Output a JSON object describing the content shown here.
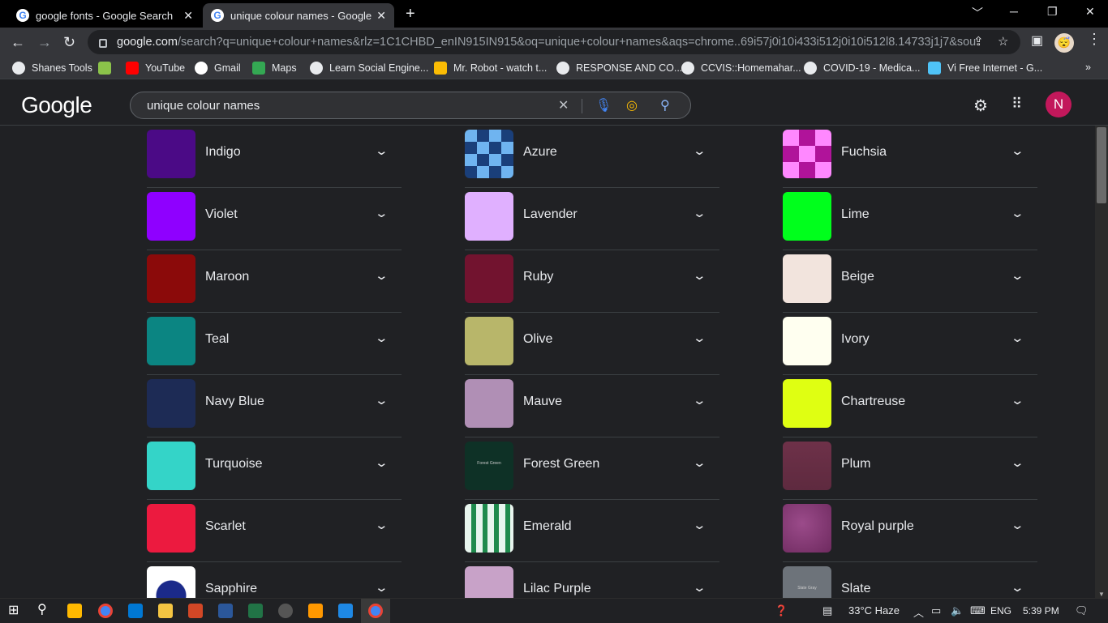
{
  "tabs": [
    {
      "title": "google fonts - Google Search",
      "active": false
    },
    {
      "title": "unique colour names - Google Se",
      "active": true
    }
  ],
  "address_bar": {
    "domain": "google.com",
    "path": "/search?q=unique+colour+names&rlz=1C1CHBD_enIN915IN915&oq=unique+colour+names&aqs=chrome..69i57j0i10i433i512j0i10i512l8.14733j1j7&sourc..."
  },
  "profile_icon": "😴",
  "bookmarks": [
    {
      "label": "Shanes Tools",
      "icon": "globe-icon",
      "color": "#e8eaed"
    },
    {
      "label": "",
      "icon": "image-icon",
      "color": "#8bc34a"
    },
    {
      "label": "YouTube",
      "icon": "youtube-icon",
      "color": "#ff0000"
    },
    {
      "label": "Gmail",
      "icon": "google-icon",
      "color": "#ffffff"
    },
    {
      "label": "Maps",
      "icon": "maps-icon",
      "color": "#34a853"
    },
    {
      "label": "Learn Social Engine...",
      "icon": "globe-icon",
      "color": "#e8eaed"
    },
    {
      "label": "Mr. Robot - watch t...",
      "icon": "play-icon",
      "color": "#fbbc04"
    },
    {
      "label": "RESPONSE AND CO...",
      "icon": "globe-icon",
      "color": "#e8eaed"
    },
    {
      "label": "CCVIS::Homemahar...",
      "icon": "globe-icon",
      "color": "#e8eaed"
    },
    {
      "label": "COVID-19 - Medica...",
      "icon": "globe-icon",
      "color": "#e8eaed"
    },
    {
      "label": "Vi Free Internet - G...",
      "icon": "cart-icon",
      "color": "#4fc3f7"
    }
  ],
  "google": {
    "logo": "Google",
    "query": "unique colour names",
    "user_initial": "N"
  },
  "colors": [
    [
      {
        "name": "Indigo",
        "swatch": "#4b0a86"
      },
      {
        "name": "Violet",
        "swatch": "#8f00ff"
      },
      {
        "name": "Maroon",
        "swatch": "#8b0a0a"
      },
      {
        "name": "Teal",
        "swatch": "#0b8582"
      },
      {
        "name": "Navy Blue",
        "swatch": "#1d2b55"
      },
      {
        "name": "Turquoise",
        "swatch": "#34d4c8"
      },
      {
        "name": "Scarlet",
        "swatch": "#ec1a3f"
      },
      {
        "name": "Sapphire",
        "swatch": "#ffffff"
      }
    ],
    [
      {
        "name": "Azure",
        "swatch": "#2f7fe0"
      },
      {
        "name": "Lavender",
        "swatch": "#e0b0ff"
      },
      {
        "name": "Ruby",
        "swatch": "#72132f"
      },
      {
        "name": "Olive",
        "swatch": "#b8b66a"
      },
      {
        "name": "Mauve",
        "swatch": "#b08fb5"
      },
      {
        "name": "Forest Green",
        "swatch": "#0e3126"
      },
      {
        "name": "Emerald",
        "swatch": "#e8f5ee"
      },
      {
        "name": "Lilac Purple",
        "swatch": "#c8a2c8"
      }
    ],
    [
      {
        "name": "Fuchsia",
        "swatch": "#d63ad6"
      },
      {
        "name": "Lime",
        "swatch": "#00ff1c"
      },
      {
        "name": "Beige",
        "swatch": "#f2e4dd"
      },
      {
        "name": "Ivory",
        "swatch": "#fffff0"
      },
      {
        "name": "Chartreuse",
        "swatch": "#dfff12"
      },
      {
        "name": "Plum",
        "swatch": "#6e3149"
      },
      {
        "name": "Royal purple",
        "swatch": "#7f3a6e"
      },
      {
        "name": "Slate",
        "swatch": "#6d737a"
      }
    ]
  ],
  "swatch_labels": {
    "forest_green": "Forest Green",
    "slate": "Slate Gray"
  },
  "taskbar": {
    "weather": "33°C  Haze",
    "language": "ENG",
    "time": "5:39 PM"
  }
}
